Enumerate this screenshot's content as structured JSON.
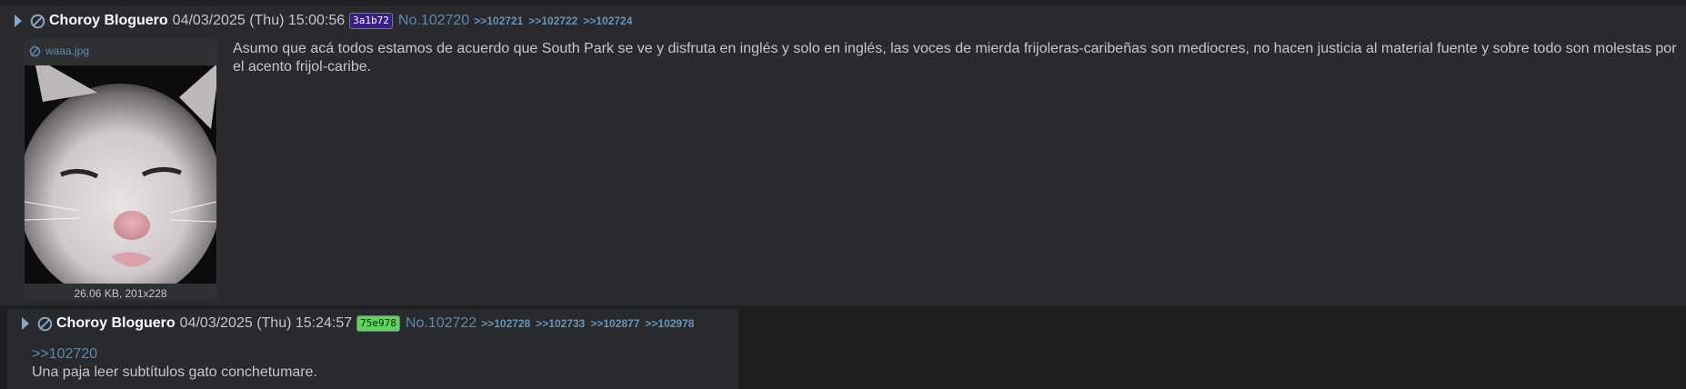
{
  "posts": [
    {
      "name": "Choroy Bloguero",
      "datetime": "04/03/2025 (Thu) 15:00:56",
      "poster_id": "3a1b72",
      "poster_id_color": "#3b1c8c",
      "post_no": "No.102720",
      "backlinks": [
        ">>102721",
        ">>102722",
        ">>102724"
      ],
      "file": {
        "name": "waaa.jpg",
        "info": "26.06 KB, 201x228"
      },
      "body": "Asumo que acá todos estamos de acuerdo que South Park se ve y disfruta en inglés y solo en inglés, las voces de mierda frijoleras-caribeñas son mediocres, no hacen justicia al material fuente y sobre todo son molestas por el acento frijol-caribe."
    },
    {
      "name": "Choroy Bloguero",
      "datetime": "04/03/2025 (Thu) 15:24:57",
      "poster_id": "75e978",
      "poster_id_color": "#5fd35f",
      "post_no": "No.102722",
      "backlinks": [
        ">>102728",
        ">>102733",
        ">>102877",
        ">>102978"
      ],
      "quote": ">>102720",
      "body": "Una paja leer subtítulos gato conchetumare."
    }
  ],
  "colors": {
    "background": "#1d1f21",
    "post_bg": "#282a2e",
    "link": "#5f89ac",
    "name": "#ffffff"
  },
  "icons": {
    "expand": "caret-right-icon",
    "hide": "circle-slash-icon"
  }
}
